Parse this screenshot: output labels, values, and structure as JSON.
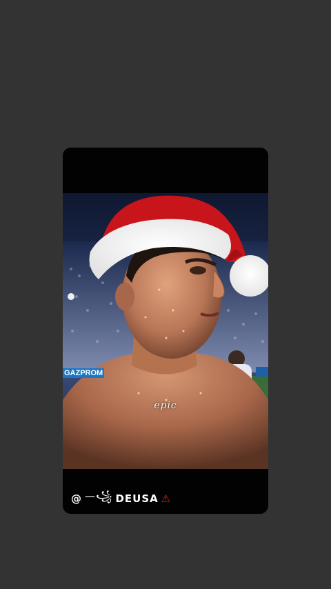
{
  "story": {
    "caption": "epic",
    "ad_board_text": "GAZPROM",
    "watermark": {
      "at_symbol": "@",
      "handle": "DEUSA",
      "decor_left": "—꧁",
      "decor_right": "⚠"
    }
  },
  "colors": {
    "background": "#333333",
    "card_bars": "#020202",
    "santa_hat_red": "#c8141b",
    "santa_hat_fur": "#ffffff",
    "skin": "#c98a66"
  },
  "icons": [
    "santa-hat-icon",
    "warning-triangle-icon"
  ]
}
